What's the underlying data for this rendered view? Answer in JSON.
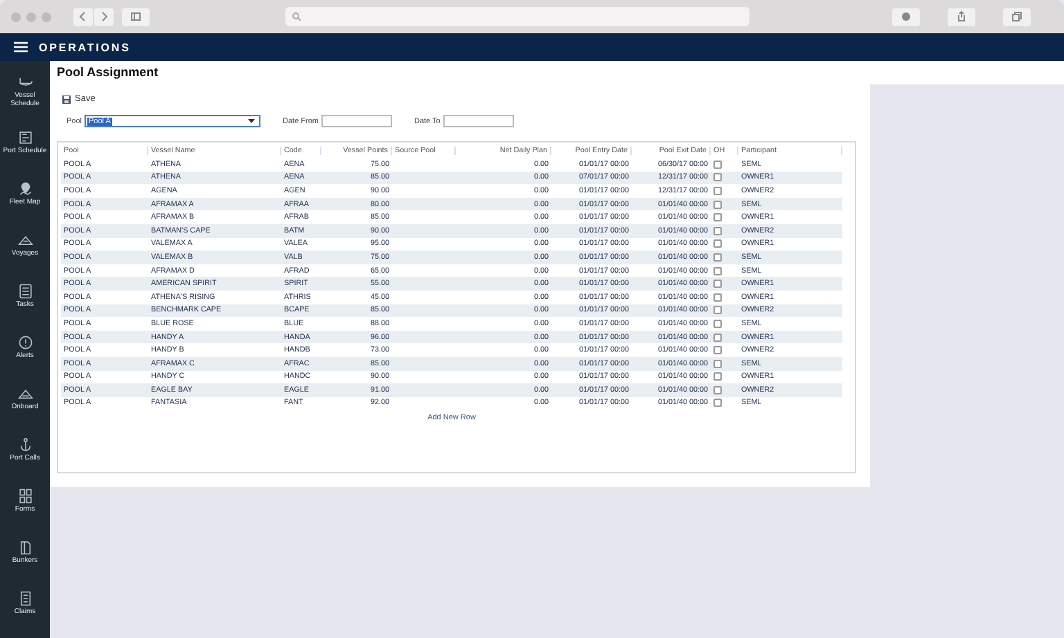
{
  "app": {
    "title": "OPERATIONS"
  },
  "sidebar": {
    "items": [
      {
        "label": "Vessel Schedule"
      },
      {
        "label": "Port Schedule"
      },
      {
        "label": "Fleet Map"
      },
      {
        "label": "Voyages"
      },
      {
        "label": "Tasks"
      },
      {
        "label": "Alerts"
      },
      {
        "label": "Onboard"
      },
      {
        "label": "Port Calls"
      },
      {
        "label": "Forms"
      },
      {
        "label": "Bunkers"
      },
      {
        "label": "Claims"
      }
    ]
  },
  "page": {
    "title": "Pool Assignment",
    "save": "Save",
    "filters": [
      {
        "kind": "select",
        "label": "Pool",
        "value": "Pool A"
      },
      {
        "kind": "date",
        "label": "Date From"
      },
      {
        "kind": "date",
        "label": "Date To"
      }
    ]
  },
  "table": {
    "columns": [
      "Pool",
      "Vessel Name",
      "Code",
      "Vessel Points",
      "Source Pool",
      "Net Daily Plan",
      "Pool Entry Date",
      "Pool Exit Date",
      "OH",
      "Participant"
    ],
    "rows": [
      {
        "pool": "POOL A",
        "vessel_name": "ATHENA",
        "code": "AENA",
        "vessel_points": "75.00",
        "net_daily_plan": "0.00",
        "pool_entry_date": "01/01/17 00:00",
        "pool_exit_date": "06/30/17 00:00",
        "oh": false,
        "participant": "SEML"
      },
      {
        "pool": "POOL A",
        "vessel_name": "ATHENA",
        "code": "AENA",
        "vessel_points": "85.00",
        "net_daily_plan": "0.00",
        "pool_entry_date": "07/01/17 00:00",
        "pool_exit_date": "12/31/17 00:00",
        "oh": false,
        "participant": "OWNER1"
      },
      {
        "pool": "POOL A",
        "vessel_name": "AGENA",
        "code": "AGEN",
        "vessel_points": "90.00",
        "net_daily_plan": "0.00",
        "pool_entry_date": "01/01/17 00:00",
        "pool_exit_date": "12/31/17 00:00",
        "oh": false,
        "participant": "OWNER2"
      },
      {
        "pool": "POOL A",
        "vessel_name": "AFRAMAX A",
        "code": "AFRAA",
        "vessel_points": "80.00",
        "net_daily_plan": "0.00",
        "pool_entry_date": "01/01/17 00:00",
        "pool_exit_date": "01/01/40 00:00",
        "oh": false,
        "participant": "SEML"
      },
      {
        "pool": "POOL A",
        "vessel_name": "AFRAMAX B",
        "code": "AFRAB",
        "vessel_points": "85.00",
        "net_daily_plan": "0.00",
        "pool_entry_date": "01/01/17 00:00",
        "pool_exit_date": "01/01/40 00:00",
        "oh": false,
        "participant": "OWNER1"
      },
      {
        "pool": "POOL A",
        "vessel_name": "BATMAN'S CAPE",
        "code": "BATM",
        "vessel_points": "90.00",
        "net_daily_plan": "0.00",
        "pool_entry_date": "01/01/17 00:00",
        "pool_exit_date": "01/01/40 00:00",
        "oh": false,
        "participant": "OWNER2"
      },
      {
        "pool": "POOL A",
        "vessel_name": "VALEMAX A",
        "code": "VALEA",
        "vessel_points": "95.00",
        "net_daily_plan": "0.00",
        "pool_entry_date": "01/01/17 00:00",
        "pool_exit_date": "01/01/40 00:00",
        "oh": false,
        "participant": "OWNER1"
      },
      {
        "pool": "POOL A",
        "vessel_name": "VALEMAX B",
        "code": "VALB",
        "vessel_points": "75.00",
        "net_daily_plan": "0.00",
        "pool_entry_date": "01/01/17 00:00",
        "pool_exit_date": "01/01/40 00:00",
        "oh": false,
        "participant": "SEML"
      },
      {
        "pool": "POOL A",
        "vessel_name": "AFRAMAX D",
        "code": "AFRAD",
        "vessel_points": "65.00",
        "net_daily_plan": "0.00",
        "pool_entry_date": "01/01/17 00:00",
        "pool_exit_date": "01/01/40 00:00",
        "oh": false,
        "participant": "SEML"
      },
      {
        "pool": "POOL A",
        "vessel_name": "AMERICAN SPIRIT",
        "code": "SPIRIT",
        "vessel_points": "55.00",
        "net_daily_plan": "0.00",
        "pool_entry_date": "01/01/17 00:00",
        "pool_exit_date": "01/01/40 00:00",
        "oh": false,
        "participant": "OWNER1"
      },
      {
        "pool": "POOL A",
        "vessel_name": "ATHENA'S RISING",
        "code": "ATHRIS",
        "vessel_points": "45.00",
        "net_daily_plan": "0.00",
        "pool_entry_date": "01/01/17 00:00",
        "pool_exit_date": "01/01/40 00:00",
        "oh": false,
        "participant": "OWNER1"
      },
      {
        "pool": "POOL A",
        "vessel_name": "BENCHMARK CAPE",
        "code": "BCAPE",
        "vessel_points": "85.00",
        "net_daily_plan": "0.00",
        "pool_entry_date": "01/01/17 00:00",
        "pool_exit_date": "01/01/40 00:00",
        "oh": false,
        "participant": "OWNER2"
      },
      {
        "pool": "POOL A",
        "vessel_name": "BLUE ROSE",
        "code": "BLUE",
        "vessel_points": "88.00",
        "net_daily_plan": "0.00",
        "pool_entry_date": "01/01/17 00:00",
        "pool_exit_date": "01/01/40 00:00",
        "oh": false,
        "participant": "SEML"
      },
      {
        "pool": "POOL A",
        "vessel_name": "HANDY A",
        "code": "HANDA",
        "vessel_points": "96.00",
        "net_daily_plan": "0.00",
        "pool_entry_date": "01/01/17 00:00",
        "pool_exit_date": "01/01/40 00:00",
        "oh": false,
        "participant": "OWNER1"
      },
      {
        "pool": "POOL A",
        "vessel_name": "HANDY B",
        "code": "HANDB",
        "vessel_points": "73.00",
        "net_daily_plan": "0.00",
        "pool_entry_date": "01/01/17 00:00",
        "pool_exit_date": "01/01/40 00:00",
        "oh": false,
        "participant": "OWNER2"
      },
      {
        "pool": "POOL A",
        "vessel_name": "AFRAMAX C",
        "code": "AFRAC",
        "vessel_points": "85.00",
        "net_daily_plan": "0.00",
        "pool_entry_date": "01/01/17 00:00",
        "pool_exit_date": "01/01/40 00:00",
        "oh": false,
        "participant": "SEML"
      },
      {
        "pool": "POOL A",
        "vessel_name": "HANDY C",
        "code": "HANDC",
        "vessel_points": "90.00",
        "net_daily_plan": "0.00",
        "pool_entry_date": "01/01/17 00:00",
        "pool_exit_date": "01/01/40 00:00",
        "oh": false,
        "participant": "OWNER1"
      },
      {
        "pool": "POOL A",
        "vessel_name": "EAGLE BAY",
        "code": "EAGLE",
        "vessel_points": "91.00",
        "net_daily_plan": "0.00",
        "pool_entry_date": "01/01/17 00:00",
        "pool_exit_date": "01/01/40 00:00",
        "oh": false,
        "participant": "OWNER2"
      },
      {
        "pool": "POOL A",
        "vessel_name": "FANTASIA",
        "code": "FANT",
        "vessel_points": "92.00",
        "net_daily_plan": "0.00",
        "pool_entry_date": "01/01/17 00:00",
        "pool_exit_date": "01/01/40 00:00",
        "oh": false,
        "participant": "SEML"
      }
    ],
    "add_row": "Add New Row"
  }
}
